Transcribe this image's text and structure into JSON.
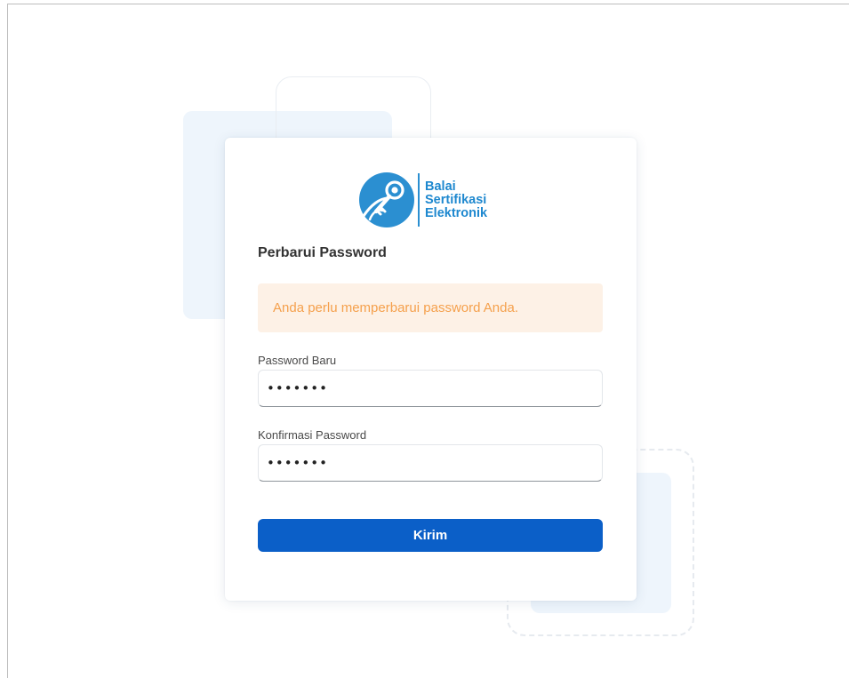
{
  "brand": {
    "line1": "Balai",
    "line2": "Sertifikasi",
    "line3": "Elektronik",
    "color": "#1e88cf"
  },
  "form": {
    "title": "Perbarui Password",
    "alert": "Anda perlu memperbarui password Anda.",
    "new_password": {
      "label": "Password Baru",
      "value": "•••••••"
    },
    "confirm_password": {
      "label": "Konfirmasi Password",
      "value": "•••••••"
    },
    "submit_label": "Kirim"
  },
  "colors": {
    "primary": "#0b5fc8",
    "alert_bg": "#fdf1e6",
    "alert_text": "#f5a04c",
    "deco_blue": "#eef5fc"
  }
}
